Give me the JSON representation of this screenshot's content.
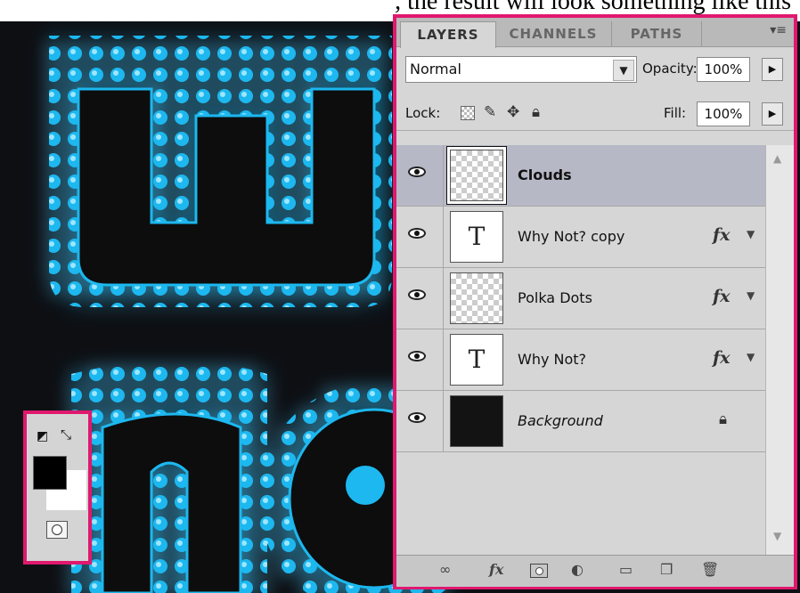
{
  "caption": {
    "text": ", the result will look something like this"
  },
  "tools": {
    "default_colors_icon": "default-colors-icon",
    "swap_colors_icon": "swap-colors-icon",
    "foreground_color": "#000000",
    "background_color": "#ffffff",
    "quick_mask_icon": "quick-mask-icon"
  },
  "panel": {
    "tabs": [
      {
        "label": "LAYERS",
        "active": true
      },
      {
        "label": "CHANNELS",
        "active": false
      },
      {
        "label": "PATHS",
        "active": false
      }
    ],
    "menu_icon": "▾≡",
    "blend_mode": "Normal",
    "opacity_label": "Opacity:",
    "opacity_value": "100%",
    "lock_label": "Lock:",
    "fill_label": "Fill:",
    "fill_value": "100%",
    "layers": [
      {
        "name": "Clouds",
        "thumb": "checker",
        "selected": true,
        "fx": false,
        "locked": false
      },
      {
        "name": "Why Not? copy",
        "thumb": "text",
        "thumb_text": "T",
        "selected": false,
        "fx": true,
        "locked": false
      },
      {
        "name": "Polka Dots",
        "thumb": "checker",
        "selected": false,
        "fx": true,
        "locked": false
      },
      {
        "name": "Why Not?",
        "thumb": "text",
        "thumb_text": "T",
        "selected": false,
        "fx": true,
        "locked": false
      },
      {
        "name": "Background",
        "thumb": "dark",
        "selected": false,
        "fx": false,
        "locked": true
      }
    ],
    "fx_label": "fx"
  },
  "colors": {
    "highlight_border": "#e0186e",
    "glow": "#1fb8ef",
    "canvas_bg": "#0d0f13"
  }
}
